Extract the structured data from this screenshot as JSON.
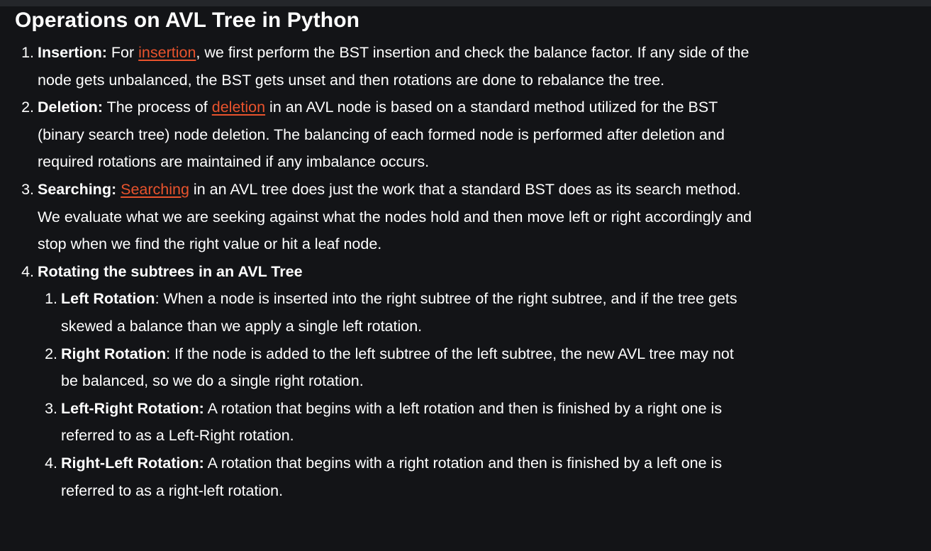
{
  "title": "Operations on AVL Tree in Python",
  "items": [
    {
      "number": "1.",
      "label": "Insertion:",
      "pre": " For ",
      "link": "insertion",
      "text": ", we first perform the BST insertion and check the balance factor. If any side of the node gets unbalanced, the BST gets unset and then rotations are done to rebalance the tree."
    },
    {
      "number": "2.",
      "label": "Deletion:",
      "pre": " The process of ",
      "link": "deletion",
      "text": " in an AVL node is based on a standard method utilized for the BST (binary search tree) node deletion. The balancing of each formed node is performed after deletion and required rotations are maintained if any imbalance occurs."
    },
    {
      "number": "3.",
      "label": "Searching:",
      "pre": " ",
      "link": "Searching",
      "text": " in an AVL tree does just the work that a standard BST does as its search method. We evaluate what we are seeking against what the nodes hold and then move left or right accordingly and stop when we find the right value or hit a leaf node."
    },
    {
      "number": "4.",
      "label": "Rotating the subtrees in an AVL Tree"
    }
  ],
  "subitems": [
    {
      "number": "1.",
      "label": "Left Rotation",
      "text": ": When a node is inserted into the right subtree of the right subtree, and if the tree gets skewed a balance than we apply a single left rotation."
    },
    {
      "number": "2.",
      "label": "Right Rotation",
      "text": ": If the node is added to the left subtree of the left subtree, the new AVL tree may not be balanced, so we do a single right rotation."
    },
    {
      "number": "3.",
      "label": "Left-Right Rotation:",
      "text": " A rotation that begins with a left rotation and then is finished by a right one is referred to as a Left-Right rotation."
    },
    {
      "number": "4.",
      "label": "Right-Left Rotation:",
      "text": " A rotation that begins with a right rotation and then is finished by a left one is referred to as a right-left rotation."
    }
  ],
  "colors": {
    "background": "#131417",
    "top_bar": "#24262a",
    "text": "#ffffff",
    "link": "#e8532d"
  }
}
